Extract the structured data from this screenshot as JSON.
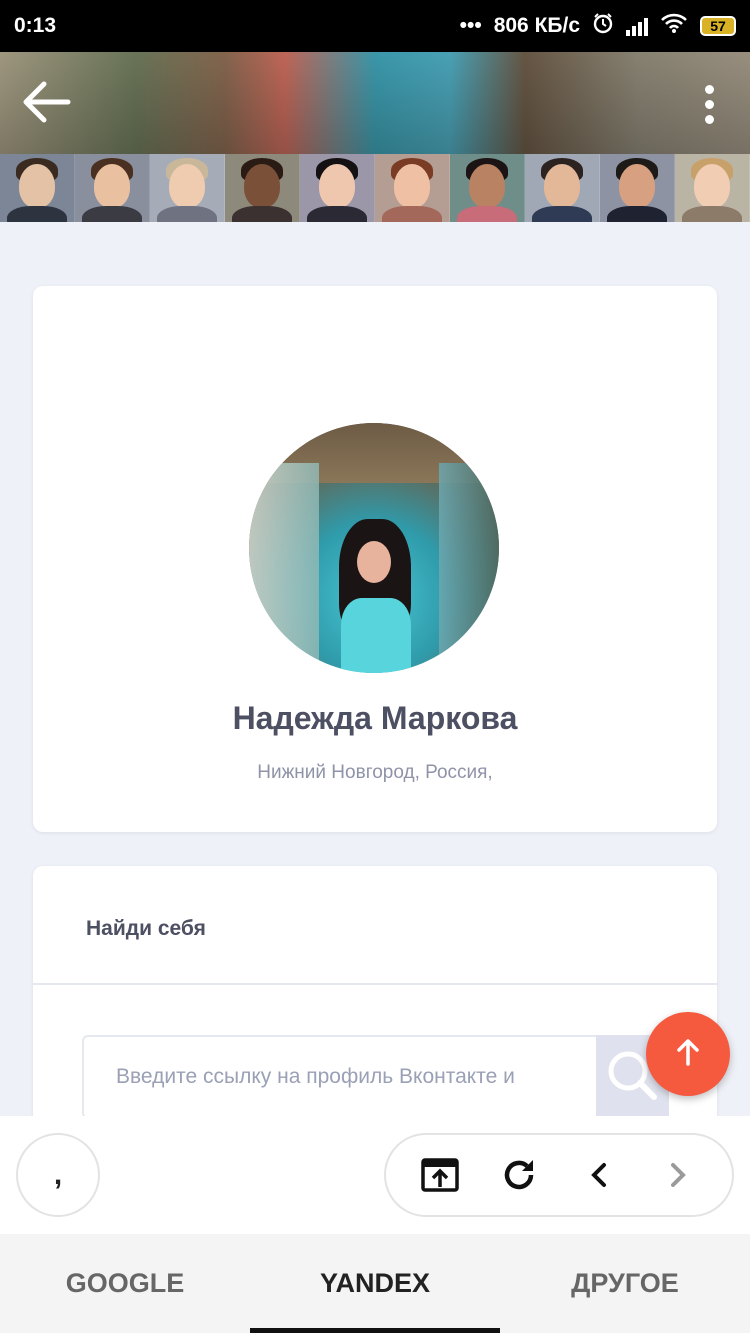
{
  "status_bar": {
    "time": "0:13",
    "dots": "•••",
    "network_speed": "806 КБ/с",
    "battery": "57",
    "icons": [
      "alarm-icon",
      "signal-icon",
      "wifi-icon",
      "battery-icon"
    ]
  },
  "header": {
    "back_icon": "arrow-left-icon",
    "menu_icon": "more-vertical-icon"
  },
  "profile": {
    "name": "Надежда Маркова",
    "location": "Нижний Новгород, Россия,"
  },
  "search_section": {
    "title": "Найди себя",
    "input_placeholder": "Введите ссылку на профиль Вконтакте и",
    "input_value": ""
  },
  "browser_toolbar": {
    "left_button_label": ",",
    "buttons": [
      "open-in-app-icon",
      "reload-icon",
      "back-chevron-icon",
      "forward-chevron-icon"
    ]
  },
  "tabs": [
    {
      "label": "GOOGLE",
      "active": false
    },
    {
      "label": "YANDEX",
      "active": true
    },
    {
      "label": "ДРУГОЕ",
      "active": false
    }
  ],
  "colors": {
    "accent_fab": "#f55a3f",
    "page_bg": "#eef1f7",
    "text_dark": "#4d4f63",
    "text_muted": "#8f93a8"
  }
}
